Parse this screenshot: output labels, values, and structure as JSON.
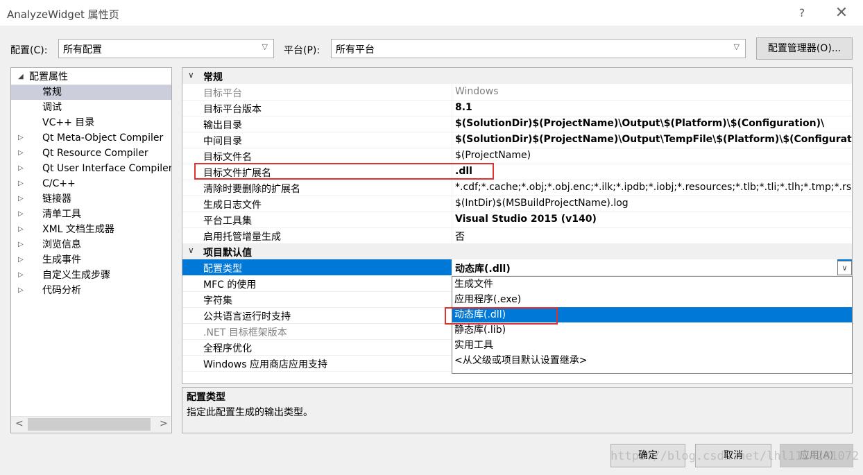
{
  "window": {
    "title": "AnalyzeWidget 属性页",
    "help": "?",
    "close": "✕"
  },
  "toolbar": {
    "config_label": "配置(C):",
    "config_value": "所有配置",
    "platform_label": "平台(P):",
    "platform_value": "所有平台",
    "config_manager": "配置管理器(O)..."
  },
  "tree": {
    "items": [
      {
        "label": "配置属性",
        "arrow": "◢"
      },
      {
        "label": "常规",
        "arrow": ""
      },
      {
        "label": "调试",
        "arrow": ""
      },
      {
        "label": "VC++ 目录",
        "arrow": ""
      },
      {
        "label": "Qt Meta-Object Compiler",
        "arrow": "▷"
      },
      {
        "label": "Qt Resource Compiler",
        "arrow": "▷"
      },
      {
        "label": "Qt User Interface Compiler",
        "arrow": "▷"
      },
      {
        "label": "C/C++",
        "arrow": "▷"
      },
      {
        "label": "链接器",
        "arrow": "▷"
      },
      {
        "label": "清单工具",
        "arrow": "▷"
      },
      {
        "label": "XML 文档生成器",
        "arrow": "▷"
      },
      {
        "label": "浏览信息",
        "arrow": "▷"
      },
      {
        "label": "生成事件",
        "arrow": "▷"
      },
      {
        "label": "自定义生成步骤",
        "arrow": "▷"
      },
      {
        "label": "代码分析",
        "arrow": "▷"
      }
    ],
    "scroll_left": "<",
    "scroll_right": ">"
  },
  "grid": {
    "cat_general": "常规",
    "cat_defaults": "项目默认值",
    "chev": "∨",
    "general_rows": [
      {
        "name": "目标平台",
        "value": "Windows"
      },
      {
        "name": "目标平台版本",
        "value": "8.1"
      },
      {
        "name": "输出目录",
        "value": "$(SolutionDir)$(ProjectName)\\Output\\$(Platform)\\$(Configuration)\\"
      },
      {
        "name": "中间目录",
        "value": "$(SolutionDir)$(ProjectName)\\Output\\TempFile\\$(Platform)\\$(Configuration)"
      },
      {
        "name": "目标文件名",
        "value": "$(ProjectName)"
      },
      {
        "name": "目标文件扩展名",
        "value": ".dll"
      },
      {
        "name": "清除时要删除的扩展名",
        "value": "*.cdf;*.cache;*.obj;*.obj.enc;*.ilk;*.ipdb;*.iobj;*.resources;*.tlb;*.tli;*.tlh;*.tmp;*.rsp"
      },
      {
        "name": "生成日志文件",
        "value": "$(IntDir)$(MSBuildProjectName).log"
      },
      {
        "name": "平台工具集",
        "value": "Visual Studio 2015 (v140)"
      },
      {
        "name": "启用托管增量生成",
        "value": "否"
      }
    ],
    "default_rows": [
      {
        "name": "配置类型",
        "value": "动态库(.dll)"
      },
      {
        "name": "MFC 的使用",
        "value": ""
      },
      {
        "name": "字符集",
        "value": ""
      },
      {
        "name": "公共语言运行时支持",
        "value": ""
      },
      {
        "name": ".NET 目标框架版本",
        "value": ""
      },
      {
        "name": "全程序优化",
        "value": ""
      },
      {
        "name": "Windows 应用商店应用支持",
        "value": ""
      }
    ],
    "combo_arrow": "∨"
  },
  "dropdown": {
    "options": [
      "生成文件",
      "应用程序(.exe)",
      "动态库(.dll)",
      "静态库(.lib)",
      "实用工具",
      "<从父级或项目默认设置继承>"
    ],
    "selected_index": 2
  },
  "description": {
    "title": "配置类型",
    "text": "指定此配置生成的输出类型。"
  },
  "buttons": {
    "ok": "确定",
    "cancel": "取消",
    "apply": "应用(A)"
  },
  "watermark": "https://blog.csdn.net/lhl1124281072"
}
